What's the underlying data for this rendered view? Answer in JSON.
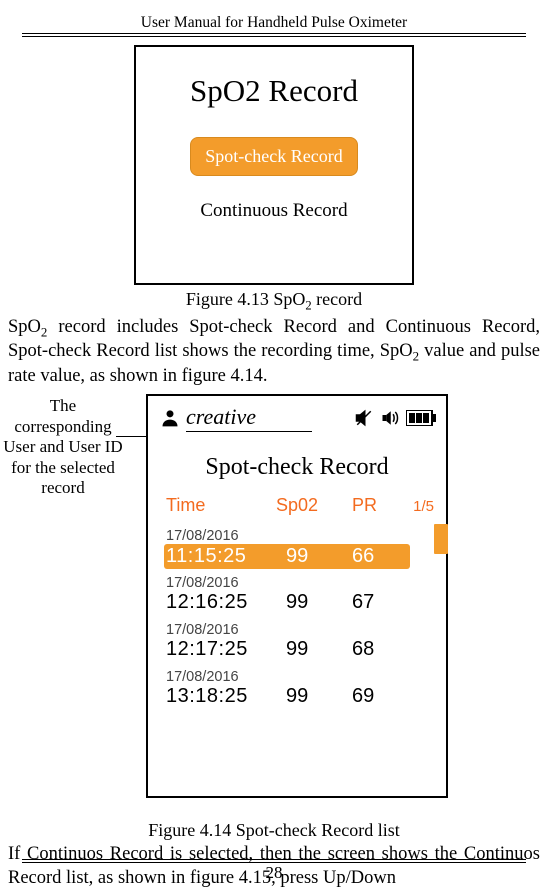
{
  "header": "User Manual for Handheld Pulse Oximeter",
  "figure1": {
    "caption_prefix": "Figure 4.13 SpO",
    "caption_suffix": " record",
    "title": "SpO2 Record",
    "option_selected": "Spot-check Record",
    "option_other": "Continuous Record"
  },
  "paragraph1": {
    "p1a": "SpO",
    "p1b": " record includes Spot-check Record and Continuous Record, Spot-check Record list shows the recording time, SpO",
    "p1c": " value and pulse rate value, as shown in figure 4.14."
  },
  "annotation": "The corresponding User and User ID for the selected record",
  "figure2": {
    "user_name": "creative",
    "title": "Spot-check Record",
    "cols": {
      "time": "Time",
      "spo2": "Sp02",
      "pr": "PR",
      "page": "1/5"
    },
    "records": [
      {
        "date": "17/08/2016",
        "time": "11:15:25",
        "spo2": "99",
        "pr": "66",
        "selected": true
      },
      {
        "date": "17/08/2016",
        "time": "12:16:25",
        "spo2": "99",
        "pr": "67",
        "selected": false
      },
      {
        "date": "17/08/2016",
        "time": "12:17:25",
        "spo2": "99",
        "pr": "68",
        "selected": false
      },
      {
        "date": "17/08/2016",
        "time": "13:18:25",
        "spo2": "99",
        "pr": "69",
        "selected": false
      }
    ],
    "caption": "Figure 4.14 Spot-check Record list"
  },
  "paragraph2": "If Continuos Record is selected, then the screen shows the Continuos Record list, as shown in figure 4.15, press Up/Down",
  "page_number": "28"
}
